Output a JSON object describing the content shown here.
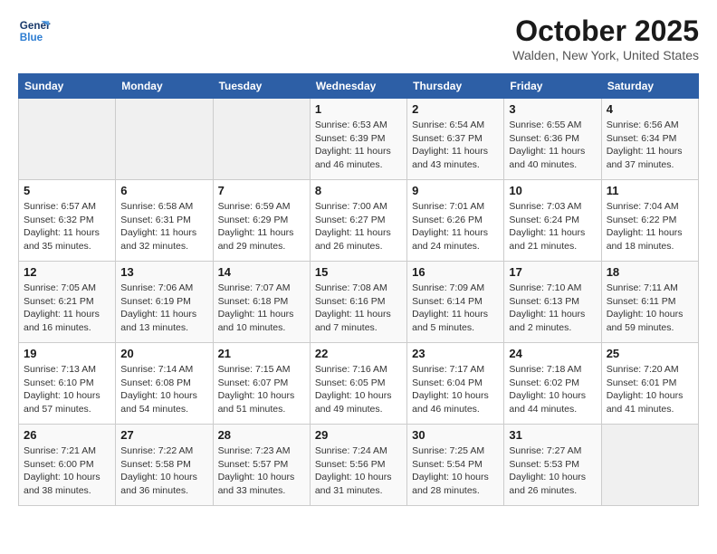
{
  "header": {
    "logo_line1": "General",
    "logo_line2": "Blue",
    "month": "October 2025",
    "location": "Walden, New York, United States"
  },
  "days_of_week": [
    "Sunday",
    "Monday",
    "Tuesday",
    "Wednesday",
    "Thursday",
    "Friday",
    "Saturday"
  ],
  "weeks": [
    [
      {
        "day": "",
        "info": ""
      },
      {
        "day": "",
        "info": ""
      },
      {
        "day": "",
        "info": ""
      },
      {
        "day": "1",
        "info": "Sunrise: 6:53 AM\nSunset: 6:39 PM\nDaylight: 11 hours\nand 46 minutes."
      },
      {
        "day": "2",
        "info": "Sunrise: 6:54 AM\nSunset: 6:37 PM\nDaylight: 11 hours\nand 43 minutes."
      },
      {
        "day": "3",
        "info": "Sunrise: 6:55 AM\nSunset: 6:36 PM\nDaylight: 11 hours\nand 40 minutes."
      },
      {
        "day": "4",
        "info": "Sunrise: 6:56 AM\nSunset: 6:34 PM\nDaylight: 11 hours\nand 37 minutes."
      }
    ],
    [
      {
        "day": "5",
        "info": "Sunrise: 6:57 AM\nSunset: 6:32 PM\nDaylight: 11 hours\nand 35 minutes."
      },
      {
        "day": "6",
        "info": "Sunrise: 6:58 AM\nSunset: 6:31 PM\nDaylight: 11 hours\nand 32 minutes."
      },
      {
        "day": "7",
        "info": "Sunrise: 6:59 AM\nSunset: 6:29 PM\nDaylight: 11 hours\nand 29 minutes."
      },
      {
        "day": "8",
        "info": "Sunrise: 7:00 AM\nSunset: 6:27 PM\nDaylight: 11 hours\nand 26 minutes."
      },
      {
        "day": "9",
        "info": "Sunrise: 7:01 AM\nSunset: 6:26 PM\nDaylight: 11 hours\nand 24 minutes."
      },
      {
        "day": "10",
        "info": "Sunrise: 7:03 AM\nSunset: 6:24 PM\nDaylight: 11 hours\nand 21 minutes."
      },
      {
        "day": "11",
        "info": "Sunrise: 7:04 AM\nSunset: 6:22 PM\nDaylight: 11 hours\nand 18 minutes."
      }
    ],
    [
      {
        "day": "12",
        "info": "Sunrise: 7:05 AM\nSunset: 6:21 PM\nDaylight: 11 hours\nand 16 minutes."
      },
      {
        "day": "13",
        "info": "Sunrise: 7:06 AM\nSunset: 6:19 PM\nDaylight: 11 hours\nand 13 minutes."
      },
      {
        "day": "14",
        "info": "Sunrise: 7:07 AM\nSunset: 6:18 PM\nDaylight: 11 hours\nand 10 minutes."
      },
      {
        "day": "15",
        "info": "Sunrise: 7:08 AM\nSunset: 6:16 PM\nDaylight: 11 hours\nand 7 minutes."
      },
      {
        "day": "16",
        "info": "Sunrise: 7:09 AM\nSunset: 6:14 PM\nDaylight: 11 hours\nand 5 minutes."
      },
      {
        "day": "17",
        "info": "Sunrise: 7:10 AM\nSunset: 6:13 PM\nDaylight: 11 hours\nand 2 minutes."
      },
      {
        "day": "18",
        "info": "Sunrise: 7:11 AM\nSunset: 6:11 PM\nDaylight: 10 hours\nand 59 minutes."
      }
    ],
    [
      {
        "day": "19",
        "info": "Sunrise: 7:13 AM\nSunset: 6:10 PM\nDaylight: 10 hours\nand 57 minutes."
      },
      {
        "day": "20",
        "info": "Sunrise: 7:14 AM\nSunset: 6:08 PM\nDaylight: 10 hours\nand 54 minutes."
      },
      {
        "day": "21",
        "info": "Sunrise: 7:15 AM\nSunset: 6:07 PM\nDaylight: 10 hours\nand 51 minutes."
      },
      {
        "day": "22",
        "info": "Sunrise: 7:16 AM\nSunset: 6:05 PM\nDaylight: 10 hours\nand 49 minutes."
      },
      {
        "day": "23",
        "info": "Sunrise: 7:17 AM\nSunset: 6:04 PM\nDaylight: 10 hours\nand 46 minutes."
      },
      {
        "day": "24",
        "info": "Sunrise: 7:18 AM\nSunset: 6:02 PM\nDaylight: 10 hours\nand 44 minutes."
      },
      {
        "day": "25",
        "info": "Sunrise: 7:20 AM\nSunset: 6:01 PM\nDaylight: 10 hours\nand 41 minutes."
      }
    ],
    [
      {
        "day": "26",
        "info": "Sunrise: 7:21 AM\nSunset: 6:00 PM\nDaylight: 10 hours\nand 38 minutes."
      },
      {
        "day": "27",
        "info": "Sunrise: 7:22 AM\nSunset: 5:58 PM\nDaylight: 10 hours\nand 36 minutes."
      },
      {
        "day": "28",
        "info": "Sunrise: 7:23 AM\nSunset: 5:57 PM\nDaylight: 10 hours\nand 33 minutes."
      },
      {
        "day": "29",
        "info": "Sunrise: 7:24 AM\nSunset: 5:56 PM\nDaylight: 10 hours\nand 31 minutes."
      },
      {
        "day": "30",
        "info": "Sunrise: 7:25 AM\nSunset: 5:54 PM\nDaylight: 10 hours\nand 28 minutes."
      },
      {
        "day": "31",
        "info": "Sunrise: 7:27 AM\nSunset: 5:53 PM\nDaylight: 10 hours\nand 26 minutes."
      },
      {
        "day": "",
        "info": ""
      }
    ]
  ]
}
